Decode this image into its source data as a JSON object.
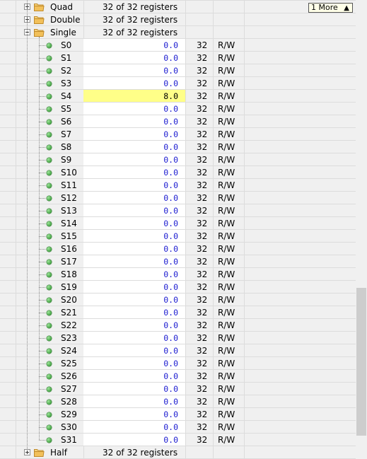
{
  "more_button": {
    "label": "1 More"
  },
  "groups_top": [
    {
      "name": "Quad",
      "count": "32 of 32 registers",
      "expanded": false
    },
    {
      "name": "Double",
      "count": "32 of 32 registers",
      "expanded": false
    },
    {
      "name": "Single",
      "count": "32 of 32 registers",
      "expanded": true
    }
  ],
  "registers": [
    {
      "name": "S0",
      "value": "0.0",
      "bits": "32",
      "access": "R/W"
    },
    {
      "name": "S1",
      "value": "0.0",
      "bits": "32",
      "access": "R/W"
    },
    {
      "name": "S2",
      "value": "0.0",
      "bits": "32",
      "access": "R/W"
    },
    {
      "name": "S3",
      "value": "0.0",
      "bits": "32",
      "access": "R/W"
    },
    {
      "name": "S4",
      "value": "8.0",
      "bits": "32",
      "access": "R/W",
      "changed": true
    },
    {
      "name": "S5",
      "value": "0.0",
      "bits": "32",
      "access": "R/W"
    },
    {
      "name": "S6",
      "value": "0.0",
      "bits": "32",
      "access": "R/W"
    },
    {
      "name": "S7",
      "value": "0.0",
      "bits": "32",
      "access": "R/W"
    },
    {
      "name": "S8",
      "value": "0.0",
      "bits": "32",
      "access": "R/W"
    },
    {
      "name": "S9",
      "value": "0.0",
      "bits": "32",
      "access": "R/W"
    },
    {
      "name": "S10",
      "value": "0.0",
      "bits": "32",
      "access": "R/W"
    },
    {
      "name": "S11",
      "value": "0.0",
      "bits": "32",
      "access": "R/W"
    },
    {
      "name": "S12",
      "value": "0.0",
      "bits": "32",
      "access": "R/W"
    },
    {
      "name": "S13",
      "value": "0.0",
      "bits": "32",
      "access": "R/W"
    },
    {
      "name": "S14",
      "value": "0.0",
      "bits": "32",
      "access": "R/W"
    },
    {
      "name": "S15",
      "value": "0.0",
      "bits": "32",
      "access": "R/W"
    },
    {
      "name": "S16",
      "value": "0.0",
      "bits": "32",
      "access": "R/W"
    },
    {
      "name": "S17",
      "value": "0.0",
      "bits": "32",
      "access": "R/W"
    },
    {
      "name": "S18",
      "value": "0.0",
      "bits": "32",
      "access": "R/W"
    },
    {
      "name": "S19",
      "value": "0.0",
      "bits": "32",
      "access": "R/W"
    },
    {
      "name": "S20",
      "value": "0.0",
      "bits": "32",
      "access": "R/W"
    },
    {
      "name": "S21",
      "value": "0.0",
      "bits": "32",
      "access": "R/W"
    },
    {
      "name": "S22",
      "value": "0.0",
      "bits": "32",
      "access": "R/W"
    },
    {
      "name": "S23",
      "value": "0.0",
      "bits": "32",
      "access": "R/W"
    },
    {
      "name": "S24",
      "value": "0.0",
      "bits": "32",
      "access": "R/W"
    },
    {
      "name": "S25",
      "value": "0.0",
      "bits": "32",
      "access": "R/W"
    },
    {
      "name": "S26",
      "value": "0.0",
      "bits": "32",
      "access": "R/W"
    },
    {
      "name": "S27",
      "value": "0.0",
      "bits": "32",
      "access": "R/W"
    },
    {
      "name": "S28",
      "value": "0.0",
      "bits": "32",
      "access": "R/W"
    },
    {
      "name": "S29",
      "value": "0.0",
      "bits": "32",
      "access": "R/W"
    },
    {
      "name": "S30",
      "value": "0.0",
      "bits": "32",
      "access": "R/W"
    },
    {
      "name": "S31",
      "value": "0.0",
      "bits": "32",
      "access": "R/W"
    }
  ],
  "groups_bottom": [
    {
      "name": "Half",
      "count": "32 of 32 registers",
      "expanded": false
    }
  ],
  "icons": {
    "expander": "expand-collapse-icon",
    "folder": "folder-icon",
    "register": "register-status-dot-icon",
    "more_arrow": "arrow-up-icon"
  },
  "colors": {
    "value_text": "#1b1bd0",
    "changed_value_bg": "#ffff88",
    "folder": "#f2c05a",
    "status_dot": "#3f9e3f"
  }
}
